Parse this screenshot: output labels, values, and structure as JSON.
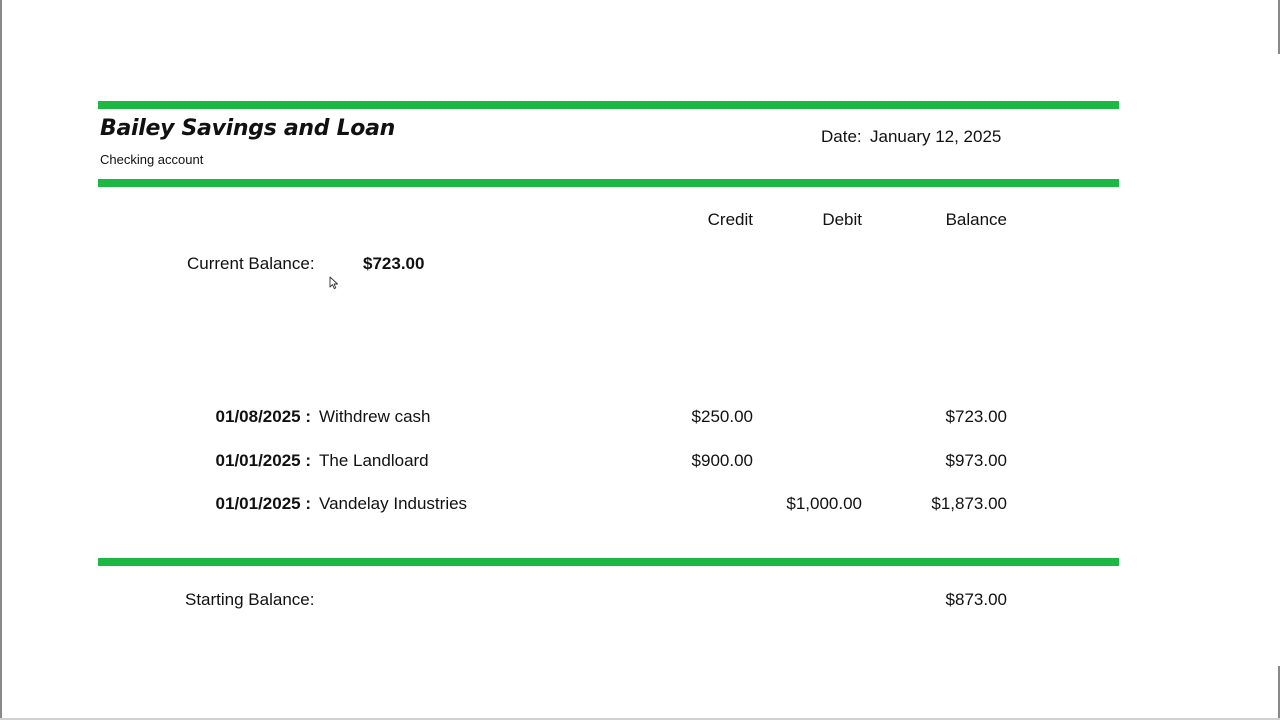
{
  "colors": {
    "accent": "#1db744"
  },
  "header": {
    "bank_name": "Bailey Savings and Loan",
    "account_type": "Checking account",
    "date_label": "Date:",
    "date_value": "January 12, 2025"
  },
  "columns": {
    "credit": "Credit",
    "debit": "Debit",
    "balance": "Balance"
  },
  "current_balance": {
    "label": "Current Balance:",
    "value": "$723.00"
  },
  "transactions": [
    {
      "date": "01/08/2025 :",
      "description": "Withdrew cash",
      "credit": "$250.00",
      "debit": "",
      "balance": "$723.00"
    },
    {
      "date": "01/01/2025 :",
      "description": "The Landloard",
      "credit": "$900.00",
      "debit": "",
      "balance": "$973.00"
    },
    {
      "date": "01/01/2025 :",
      "description": "Vandelay Industries",
      "credit": "",
      "debit": "$1,000.00",
      "balance": "$1,873.00"
    }
  ],
  "starting_balance": {
    "label": "Starting Balance:",
    "value": "$873.00"
  }
}
